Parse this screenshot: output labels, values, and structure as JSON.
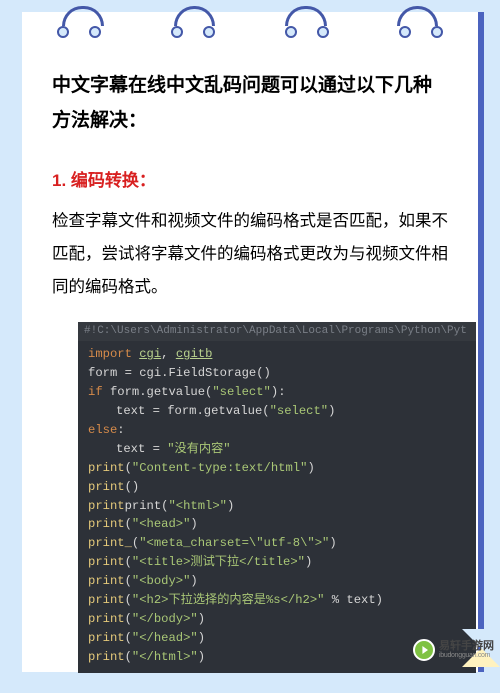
{
  "heading": "中文字幕在线中文乱码问题可以通过以下几种方法解决：",
  "method": {
    "title": "1. 编码转换：",
    "body": "检查字幕文件和视频文件的编码格式是否匹配，如果不匹配，尝试将字幕文件的编码格式更改为与视频文件相同的编码格式。"
  },
  "code": {
    "path": "#!C:\\Users\\Administrator\\AppData\\Local\\Programs\\Python\\Pyt",
    "l1_kw": "import",
    "l1_m1": "cgi",
    "l1_sep": ", ",
    "l1_m2": "cgitb",
    "l2": "form = cgi.FieldStorage()",
    "l3_kw": "if",
    "l3_rest": " form.getvalue(",
    "l3_str": "\"select\"",
    "l3_end": "):",
    "l4_a": "text = form.getvalue(",
    "l4_str": "\"select\"",
    "l4_b": ")",
    "l5_kw": "else",
    "l5_colon": ":",
    "l6_a": "text = ",
    "l6_str": "\"没有内容\"",
    "l7_fn": "print",
    "l7_a": "(",
    "l7_str": "\"Content-type:text/html\"",
    "l7_b": ")",
    "l8": "print()",
    "l9_a": "print(",
    "l9_str": "\"<html>\"",
    "l9_b": ")",
    "l10_a": "print(",
    "l10_str": "\"<head>\"",
    "l10_b": ")",
    "l11_a": "print_(",
    "l11_str": "\"<meta_charset=\\\"utf-8\\\">\"",
    "l11_b": ")",
    "l12_a": "print(",
    "l12_str": "\"<title>测试下拉</title>\"",
    "l12_b": ")",
    "l13_a": "print(",
    "l13_str": "\"<body>\"",
    "l13_b": ")",
    "l14_a": "print(",
    "l14_str": "\"<h2>下拉选择的内容是%s</h2>\"",
    "l14_b": " % text)",
    "l15_a": "print(",
    "l15_str": "\"</body>\"",
    "l15_b": ")",
    "l16_a": "print(",
    "l16_str": "\"</head>\"",
    "l16_b": ")",
    "l17_a": "print(",
    "l17_str": "\"</html>\"",
    "l17_b": ")"
  },
  "watermark": {
    "cn": "易轩手游网",
    "en": "ibudongguan.com"
  }
}
